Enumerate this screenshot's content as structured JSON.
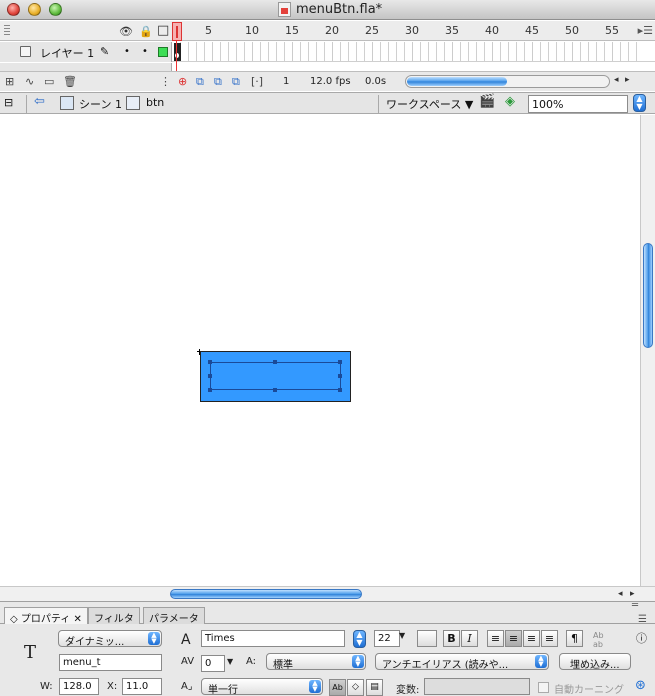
{
  "window": {
    "title": "menuBtn.fla*"
  },
  "timeline": {
    "frame_numbers": [
      "1",
      "5",
      "10",
      "15",
      "20",
      "25",
      "30",
      "35",
      "40",
      "45",
      "50",
      "55"
    ],
    "layer_name": "レイヤー 1",
    "current_frame": "1",
    "frame_rate": "12.0 fps",
    "elapsed_time": "0.0s"
  },
  "editbar": {
    "scene_label": "シーン 1",
    "symbol_label": "btn",
    "workspace_label": "ワークスペース ▼",
    "zoom_value": "100%"
  },
  "stage": {
    "button_fill_color": "#3399ff"
  },
  "properties": {
    "tabs": [
      "プロパティ",
      "フィルタ",
      "パラメータ"
    ],
    "text_type": "ダイナミッ...",
    "instance_name": "menu_t",
    "font_family": "Times",
    "font_size": "22",
    "letter_spacing": "0",
    "baseline_position": "標準",
    "antialias": "アンチエイリアス (読みや...",
    "embed_button": "埋め込み...",
    "width_label": "W:",
    "width_value": "128.0",
    "x_label": "X:",
    "x_value": "11.0",
    "line_type": "単一行",
    "variable_label": "変数:",
    "auto_kerning_label": "自動カーニング",
    "bold_label": "B",
    "italic_label": "I",
    "text_tool_glyph": "T",
    "paragraph_glyph": "¶"
  }
}
